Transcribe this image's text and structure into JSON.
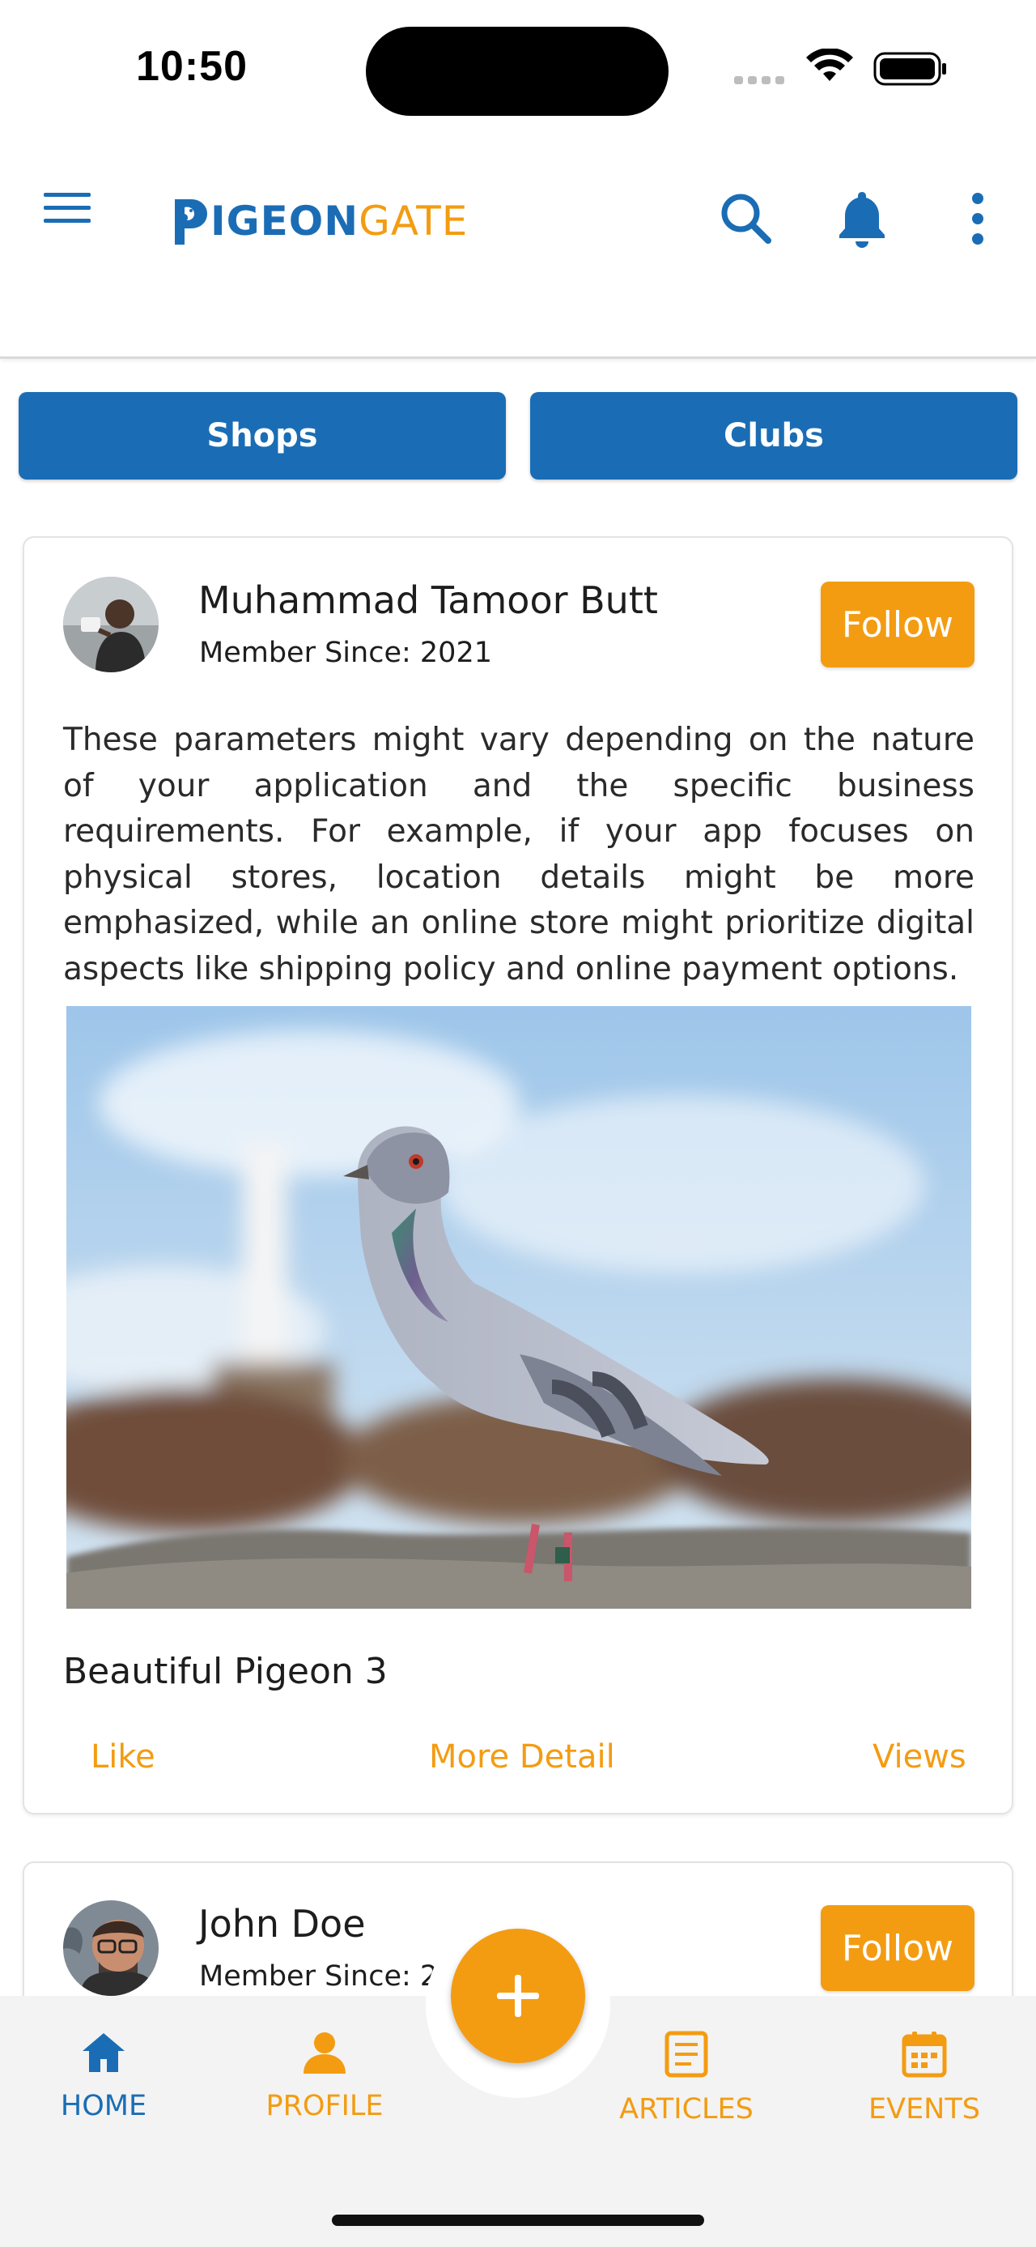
{
  "status_bar": {
    "time": "10:50"
  },
  "header": {
    "logo_strong": "IGEON",
    "logo_light": "GATE",
    "icons": [
      "menu-icon",
      "search-icon",
      "bell-icon",
      "more-vertical-icon"
    ]
  },
  "tabs": {
    "shops": "Shops",
    "clubs": "Clubs"
  },
  "posts": [
    {
      "author": "Muhammad Tamoor Butt",
      "member_since": "Member Since: 2021",
      "follow": "Follow",
      "text": "These parameters might vary depending on the nature of your application and the specific business requirements. For example, if your app focuses on physical stores, location details might be more emphasized, while an online store might prioritize digital aspects like shipping policy and online payment options.",
      "title": "Beautiful Pigeon 3",
      "actions": {
        "like": "Like",
        "more": "More Detail",
        "views": "Views"
      }
    },
    {
      "author": "John Doe",
      "member_since": "Member Since: 202",
      "follow": "Follow"
    }
  ],
  "bottom_nav": {
    "home": "HOME",
    "profile": "PROFILE",
    "articles": "ARTICLES",
    "events": "EVENTS",
    "fab_icon": "plus-icon"
  },
  "colors": {
    "primary": "#1a6db5",
    "accent": "#f39c12",
    "nav_bg": "#f3f3f3"
  }
}
